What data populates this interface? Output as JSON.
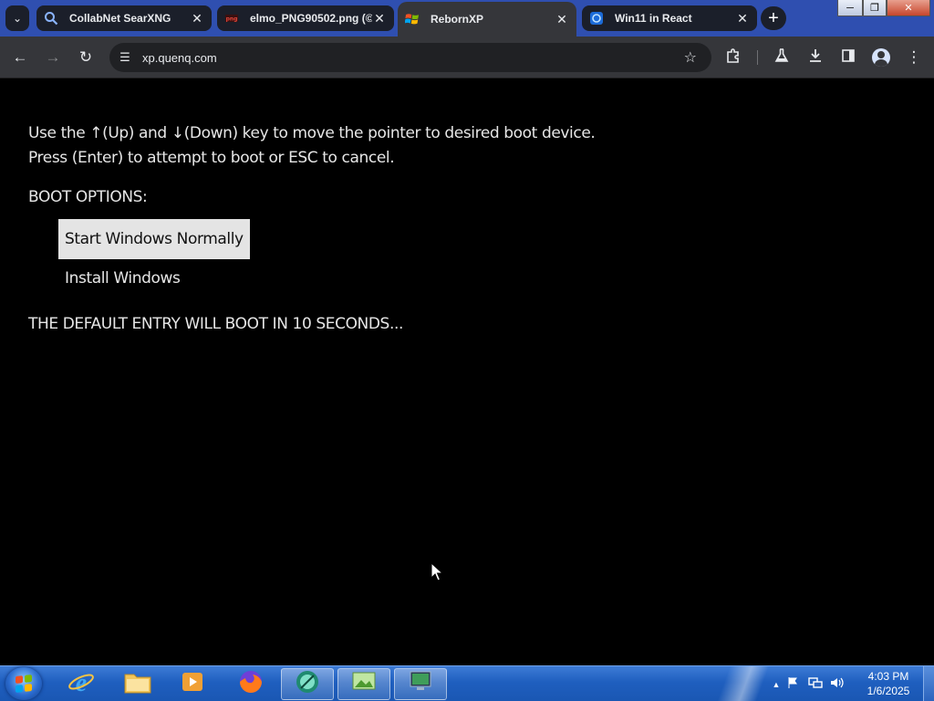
{
  "browser": {
    "tabs": [
      {
        "title": "CollabNet SearXNG",
        "icon": "search-icon",
        "active": false
      },
      {
        "title": "elmo_PNG90502.png (©",
        "icon": "image-file-icon",
        "active": false
      },
      {
        "title": "RebornXP",
        "icon": "windows-xp-logo-icon",
        "active": true
      },
      {
        "title": "Win11 in React",
        "icon": "globe-icon",
        "active": false
      }
    ],
    "url": "xp.quenq.com",
    "colors": {
      "tabstrip": "#2f4fb0",
      "toolbar": "#35363a",
      "omnibox": "#202124"
    }
  },
  "boot": {
    "instruction_line1": "Use the ↑(Up) and ↓(Down) key to move the pointer to desired boot device.",
    "instruction_line2": "Press (Enter) to attempt to boot or ESC to cancel.",
    "options_heading": "BOOT OPTIONS:",
    "options": [
      {
        "label": "Start Windows Normally",
        "selected": true
      },
      {
        "label": "Install Windows",
        "selected": false
      }
    ],
    "countdown_text": "THE DEFAULT ENTRY WILL BOOT IN 10 SECONDS..."
  },
  "taskbar": {
    "items": [
      "internet-explorer-icon",
      "file-explorer-icon",
      "media-player-icon",
      "firefox-icon",
      "app-icon",
      "image-viewer-icon",
      "monitor-icon"
    ],
    "clock_time": "4:03 PM",
    "clock_date": "1/6/2025"
  }
}
